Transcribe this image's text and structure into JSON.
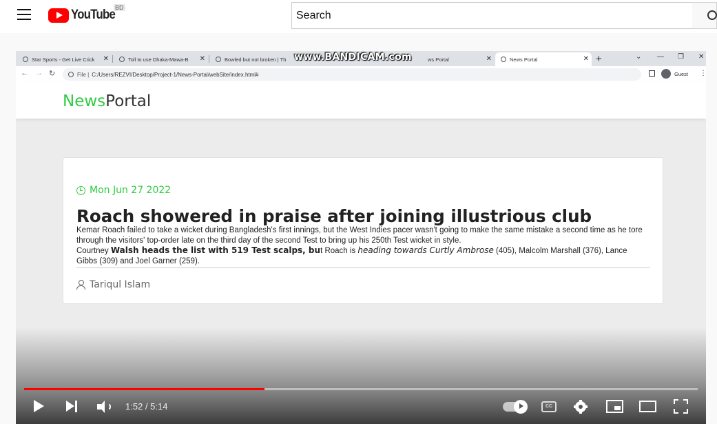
{
  "youtube": {
    "logo_text": "YouTube",
    "region_badge": "BD",
    "search_placeholder": "Search"
  },
  "browser": {
    "tabs": [
      {
        "label": "Star Sports - Get Live Crick"
      },
      {
        "label": "Toll to use Dhaka-Mawa-B"
      },
      {
        "label": "Bowled but not broken | Th"
      },
      {
        "label": "ws Portal"
      },
      {
        "label": "News Portal"
      }
    ],
    "watermark": "www.BANDICAM.com",
    "address_prefix": "File |",
    "address_url": "C:/Users/REZVI/Desktop/Project-1/News-Portal/webSite/index.html#",
    "profile_label": "Guest"
  },
  "newsportal": {
    "logo_green": "News",
    "logo_dark": "Portal",
    "article": {
      "date": "Mon Jun 27 2022",
      "title": "Roach showered in praise after joining illustrious club",
      "body_line1": "Kemar Roach failed to take a wicket during Bangladesh's first innings, but the West Indies pacer wasn't going to make the same mistake a second time as he tore through the visitors' top-order late on the third day of the second Test to bring up his 250th Test wicket in style.",
      "body_p2_start": "Courtney ",
      "body_p2_bold": "Walsh heads the list with 519 Test scalps, bu",
      "body_p2_mid": "t Roach is ",
      "body_p2_em": "heading towards Curtly Ambrose",
      "body_p2_end": " (405), Malcolm Marshall (376), Lance Gibbs (309) and Joel Garner (259).",
      "author": "Tariqul Islam"
    }
  },
  "player": {
    "current_time": "1:52",
    "duration": "5:14",
    "time_display": "1:52 / 5:14",
    "progress_fraction": 0.357,
    "progress_color": "#ff0000",
    "cc_label": "CC"
  }
}
